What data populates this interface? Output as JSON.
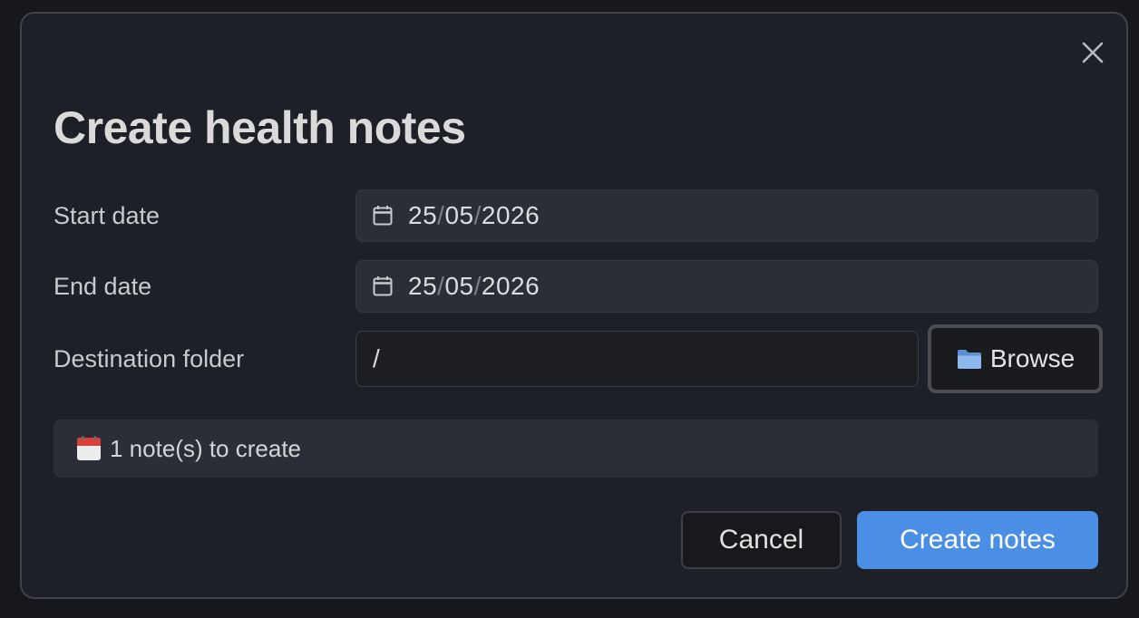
{
  "dialog": {
    "title": "Create health notes",
    "close_icon": "close-icon"
  },
  "form": {
    "start_date": {
      "label": "Start date",
      "day": "25",
      "month": "05",
      "year": "2026",
      "separator": "/",
      "icon": "calendar-icon"
    },
    "end_date": {
      "label": "End date",
      "day": "25",
      "month": "05",
      "year": "2026",
      "separator": "/",
      "icon": "calendar-icon"
    },
    "destination": {
      "label": "Destination folder",
      "value": "/",
      "browse_label": "Browse",
      "browse_icon": "folder-icon"
    }
  },
  "summary": {
    "icon": "calendar-emoji-icon",
    "text": "1 note(s) to create"
  },
  "actions": {
    "cancel_label": "Cancel",
    "create_label": "Create notes"
  },
  "colors": {
    "modal_bg": "#1d2027",
    "input_bg": "#2b2e37",
    "accent": "#4a8ee6"
  }
}
